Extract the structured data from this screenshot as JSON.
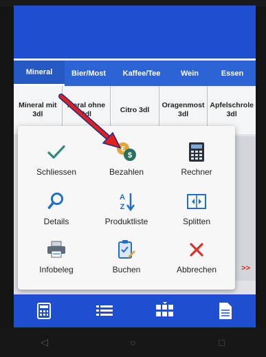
{
  "tabs": [
    {
      "label": "Mineral",
      "active": true
    },
    {
      "label": "Bier/Most",
      "active": false
    },
    {
      "label": "Kaffee/Tee",
      "active": false
    },
    {
      "label": "Wein",
      "active": false
    },
    {
      "label": "Essen",
      "active": false
    }
  ],
  "products": [
    {
      "label": "Mineral mit 3dl"
    },
    {
      "label": "...eral ohne 3dl"
    },
    {
      "label": "Citro 3dl"
    },
    {
      "label": "Oragenmost 3dl"
    },
    {
      "label": "Apfelschrole 3dl"
    }
  ],
  "more_indicator": ">>",
  "dialog": {
    "actions": [
      {
        "label": "Schliessen",
        "icon": "checkmark-icon"
      },
      {
        "label": "Bezahlen",
        "icon": "coins-icon"
      },
      {
        "label": "Rechner",
        "icon": "calculator-icon"
      },
      {
        "label": "Details",
        "icon": "magnifier-icon"
      },
      {
        "label": "Produktliste",
        "icon": "sort-az-icon"
      },
      {
        "label": "Splitten",
        "icon": "split-icon"
      },
      {
        "label": "Infobeleg",
        "icon": "printer-icon"
      },
      {
        "label": "Buchen",
        "icon": "clipboard-edit-icon"
      },
      {
        "label": "Abbrechen",
        "icon": "cross-icon"
      }
    ]
  },
  "bottom_nav": [
    {
      "icon": "calculator-icon"
    },
    {
      "icon": "list-icon"
    },
    {
      "icon": "grid-icon",
      "active": true
    },
    {
      "icon": "document-icon"
    }
  ],
  "android_nav": [
    {
      "icon": "back-icon",
      "glyph": "◁"
    },
    {
      "icon": "home-icon",
      "glyph": "○"
    },
    {
      "icon": "recents-icon",
      "glyph": "□"
    }
  ],
  "colors": {
    "primary": "#1e4fd0",
    "accent_green": "#2e8b78",
    "accent_red": "#d6302b",
    "pointer_red": "#e0201c"
  }
}
